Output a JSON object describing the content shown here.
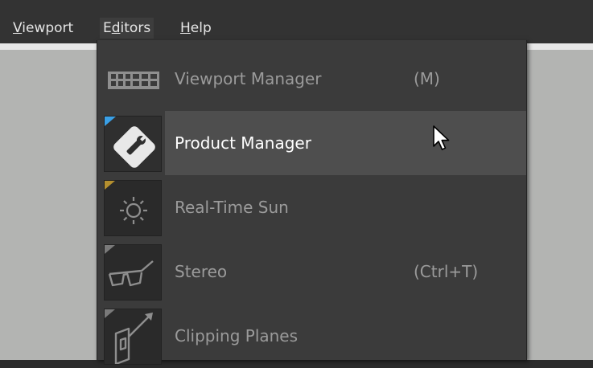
{
  "menubar": {
    "items": [
      {
        "label": "Viewport",
        "accel": "V",
        "rest": "iewport"
      },
      {
        "label": "Editors",
        "pre": "E",
        "accel": "d",
        "rest": "itors"
      },
      {
        "label": "Help",
        "accel": "H",
        "rest": "elp"
      }
    ]
  },
  "editors_menu": {
    "items": [
      {
        "label": "Viewport Manager",
        "shortcut": "(M)",
        "icon": "viewport-manager-icon",
        "indicator": "none"
      },
      {
        "label": "Product Manager",
        "shortcut": "",
        "icon": "wrench-icon",
        "indicator": "#3aa0e6",
        "highlighted": true
      },
      {
        "label": "Real-Time Sun",
        "shortcut": "",
        "icon": "sun-icon",
        "indicator": "#b5902f"
      },
      {
        "label": "Stereo",
        "shortcut": "(Ctrl+T)",
        "icon": "stereo-glasses-icon",
        "indicator": "#7a7a7a"
      },
      {
        "label": "Clipping Planes",
        "shortcut": "",
        "icon": "clipping-planes-icon",
        "indicator": "#7a7a7a"
      }
    ]
  },
  "colors": {
    "menubar_bg": "#333333",
    "menu_bg": "#3b3b3b",
    "hover_bg": "#4e4e4e",
    "viewport_bg": "#b3b4b2"
  }
}
